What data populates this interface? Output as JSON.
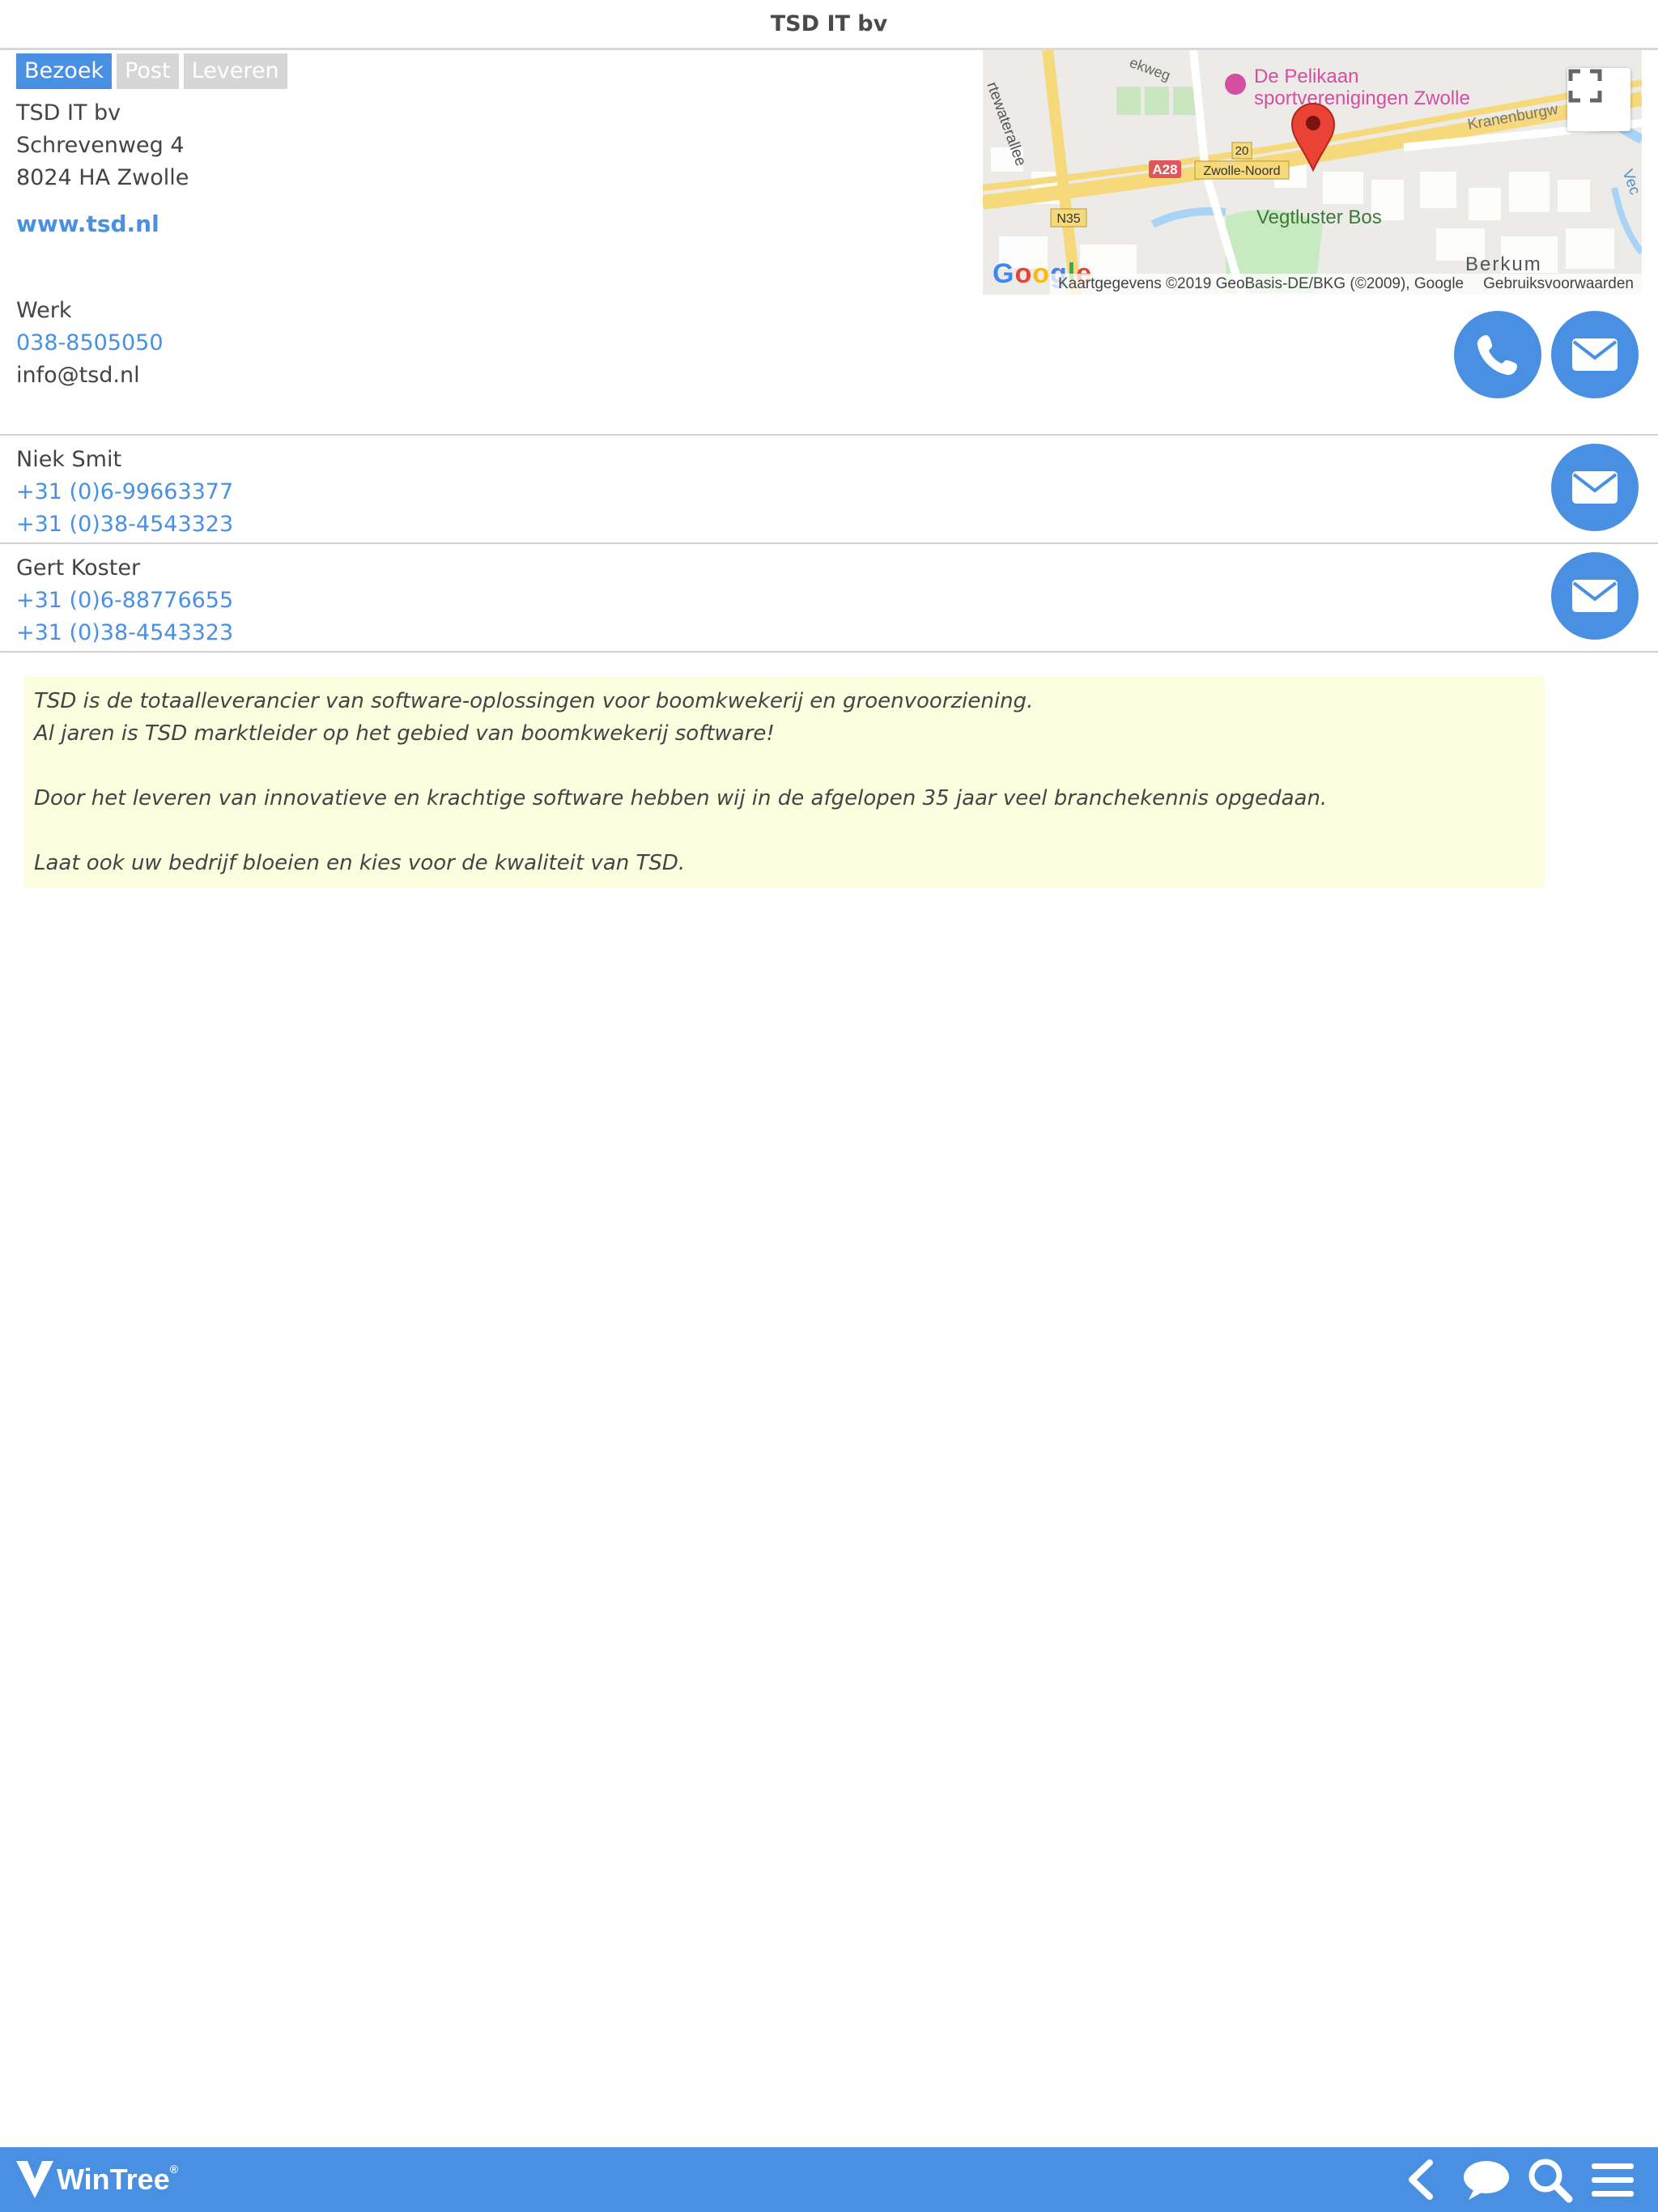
{
  "header": {
    "title": "TSD IT bv"
  },
  "tabs": [
    {
      "label": "Bezoek",
      "active": true
    },
    {
      "label": "Post",
      "active": false
    },
    {
      "label": "Leveren",
      "active": false
    }
  ],
  "address": {
    "name": "TSD IT bv",
    "street": "Schrevenweg 4",
    "city": "8024 HA Zwolle"
  },
  "website": "www.tsd.nl",
  "werk": {
    "label": "Werk",
    "phone": "038-8505050",
    "email": "info@tsd.nl"
  },
  "map": {
    "labels": {
      "poi_line1": "De Pelikaan",
      "poi_line2": "sportverenigingen Zwolle",
      "road_a28": "A28",
      "exit_20": "20",
      "exit_name": "Zwolle-Noord",
      "road_n35": "N35",
      "park": "Vegtluster Bos",
      "district": "Berkum",
      "street1": "Kranenburgw",
      "street2": "rtewaterallee",
      "street3": "ekweg",
      "street4": "Vec"
    },
    "google": "Google",
    "credit": "Kaartgegevens ©2019 GeoBasis-DE/BKG (©2009), Google",
    "terms": "Gebruiksvoorwaarden"
  },
  "contacts": [
    {
      "name": "Niek Smit",
      "mobile": "+31 (0)6-99663377",
      "phone": "+31 (0)38-4543323"
    },
    {
      "name": "Gert Koster",
      "mobile": "+31 (0)6-88776655",
      "phone": "+31 (0)38-4543323"
    }
  ],
  "about": {
    "line1": "TSD is de totaalleverancier van software-oplossingen voor boomkwekerij en groenvoorziening.",
    "line2": "Al jaren is TSD marktleider op het gebied van boomkwekerij software!",
    "line3": "Door het leveren van innovatieve en krachtige software hebben wij in de afgelopen 35 jaar veel branchekennis opgedaan.",
    "line4": "Laat ook uw bedrijf bloeien en kies voor de kwaliteit van TSD."
  },
  "footer": {
    "brand": "WinTree",
    "brand_mark": "®",
    "icons": [
      "back-icon",
      "chat-icon",
      "search-icon",
      "menu-icon"
    ]
  },
  "colors": {
    "accent": "#4a90e2",
    "tab_inactive": "#d6d6d6",
    "note_bg": "#fdfde0"
  }
}
